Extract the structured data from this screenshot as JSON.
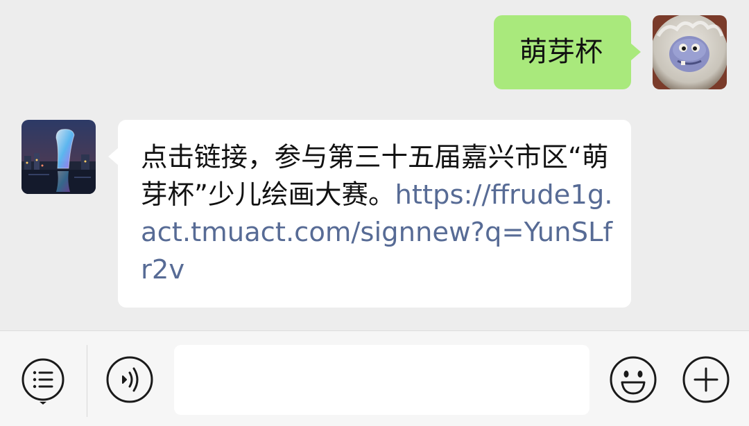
{
  "messages": [
    {
      "sender": "self",
      "text": "萌芽杯"
    },
    {
      "sender": "other",
      "text": "点击链接，参与第三十五届嘉兴市区“萌芽杯”少儿绘画大赛。",
      "link": "https://ffrude1g.act.tmuact.com/signnew?q=YunSLfr2v"
    }
  ],
  "input_bar": {
    "menu_icon": "menu-list-icon",
    "voice_icon": "voice-icon",
    "message_input_value": "",
    "emoji_icon": "emoji-icon",
    "plus_icon": "plus-icon"
  },
  "colors": {
    "chat_background": "#ededed",
    "self_bubble": "#a9e97c",
    "other_bubble": "#ffffff",
    "link": "#576b95",
    "input_bar_background": "#f6f6f6",
    "icon_stroke": "#1a1a1a"
  }
}
